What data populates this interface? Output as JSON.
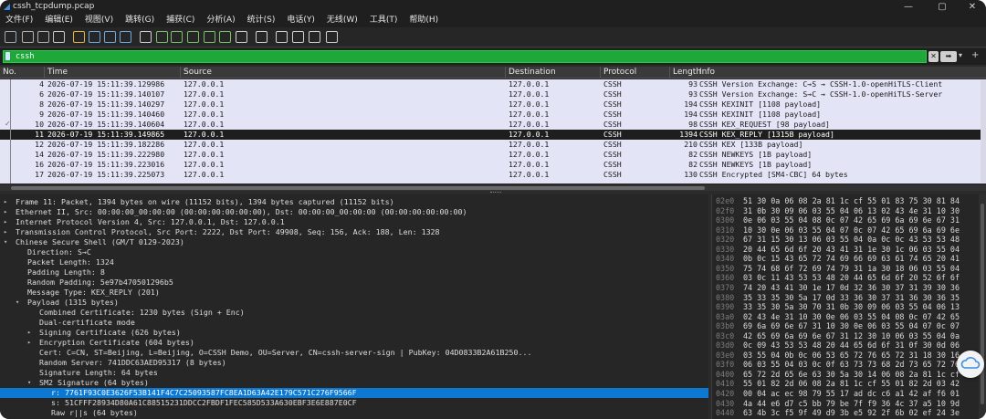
{
  "window": {
    "title": "cssh_tcpdump.pcap",
    "controls": [
      "—",
      "▢",
      "✕"
    ]
  },
  "menu": [
    "文件(F)",
    "编辑(E)",
    "视图(V)",
    "跳转(G)",
    "捕获(C)",
    "分析(A)",
    "统计(S)",
    "电话(Y)",
    "无线(W)",
    "工具(T)",
    "帮助(H)"
  ],
  "toolbar_icons": [
    "shark-fin-start-icon",
    "stop-icon",
    "restart-icon",
    "options-gear-icon",
    "open-folder-icon",
    "save-icon",
    "close-file-icon",
    "reload-icon",
    "find-icon",
    "back-arrow-icon",
    "forward-arrow-icon",
    "go-to-packet-icon",
    "first-packet-icon",
    "last-packet-icon",
    "autoscroll-icon",
    "colorize-icon",
    "zoom-in-icon",
    "zoom-out-icon",
    "normal-size-icon",
    "resize-columns-icon"
  ],
  "filter": {
    "value": "cssh"
  },
  "packet_list": {
    "columns": [
      "No.",
      "Time",
      "Source",
      "Destination",
      "Protocol",
      "Length",
      "Info"
    ],
    "rows": [
      {
        "no": "4",
        "time": "2026-07-19 15:11:39.129986",
        "src": "127.0.0.1",
        "dst": "127.0.0.1",
        "proto": "CSSH",
        "len": "93",
        "info": "CSSH Version Exchange: C→S → CSSH-1.0-openHiTLS-Client",
        "selected": false
      },
      {
        "no": "6",
        "time": "2026-07-19 15:11:39.140107",
        "src": "127.0.0.1",
        "dst": "127.0.0.1",
        "proto": "CSSH",
        "len": "93",
        "info": "CSSH Version Exchange: S→C → CSSH-1.0-openHiTLS-Server",
        "selected": false
      },
      {
        "no": "8",
        "time": "2026-07-19 15:11:39.140297",
        "src": "127.0.0.1",
        "dst": "127.0.0.1",
        "proto": "CSSH",
        "len": "194",
        "info": "CSSH KEXINIT  [1108 payload]",
        "selected": false
      },
      {
        "no": "9",
        "time": "2026-07-19 15:11:39.140460",
        "src": "127.0.0.1",
        "dst": "127.0.0.1",
        "proto": "CSSH",
        "len": "194",
        "info": "CSSH KEXINIT  [1108 payload]",
        "selected": false
      },
      {
        "no": "10",
        "time": "2026-07-19 15:11:39.140604",
        "src": "127.0.0.1",
        "dst": "127.0.0.1",
        "proto": "CSSH",
        "len": "98",
        "info": "CSSH KEX_REQUEST  [98 payload]",
        "selected": false
      },
      {
        "no": "11",
        "time": "2026-07-19 15:11:39.149865",
        "src": "127.0.0.1",
        "dst": "127.0.0.1",
        "proto": "CSSH",
        "len": "1394",
        "info": "CSSH KEX_REPLY  [1315B payload]",
        "selected": true
      },
      {
        "no": "12",
        "time": "2026-07-19 15:11:39.182286",
        "src": "127.0.0.1",
        "dst": "127.0.0.1",
        "proto": "CSSH",
        "len": "210",
        "info": "CSSH KEX  [133B payload]",
        "selected": false
      },
      {
        "no": "14",
        "time": "2026-07-19 15:11:39.222980",
        "src": "127.0.0.1",
        "dst": "127.0.0.1",
        "proto": "CSSH",
        "len": "82",
        "info": "CSSH NEWKEYS  [1B payload]",
        "selected": false
      },
      {
        "no": "16",
        "time": "2026-07-19 15:11:39.223016",
        "src": "127.0.0.1",
        "dst": "127.0.0.1",
        "proto": "CSSH",
        "len": "82",
        "info": "CSSH NEWKEYS  [1B payload]",
        "selected": false
      },
      {
        "no": "17",
        "time": "2026-07-19 15:11:39.225073",
        "src": "127.0.0.1",
        "dst": "127.0.0.1",
        "proto": "CSSH",
        "len": "130",
        "info": "CSSH Encrypted [SM4-CBC]  64 bytes",
        "selected": false
      }
    ]
  },
  "detail_tree": [
    {
      "level": 0,
      "arrow": "▸",
      "text": "Frame 11: Packet, 1394 bytes on wire (11152 bits), 1394 bytes captured (11152 bits)",
      "selected": false
    },
    {
      "level": 0,
      "arrow": "▸",
      "text": "Ethernet II, Src: 00:00:00_00:00:00 (00:00:00:00:00:00), Dst: 00:00:00_00:00:00 (00:00:00:00:00:00)",
      "selected": false
    },
    {
      "level": 0,
      "arrow": "▸",
      "text": "Internet Protocol Version 4, Src: 127.0.0.1, Dst: 127.0.0.1",
      "selected": false
    },
    {
      "level": 0,
      "arrow": "▸",
      "text": "Transmission Control Protocol, Src Port: 2222, Dst Port: 49908, Seq: 156, Ack: 188, Len: 1328",
      "selected": false
    },
    {
      "level": 0,
      "arrow": "▾",
      "text": "Chinese Secure Shell (GM/T 0129-2023)",
      "selected": false
    },
    {
      "level": 1,
      "arrow": "",
      "text": "Direction: S→C",
      "selected": false
    },
    {
      "level": 1,
      "arrow": "",
      "text": "Packet Length: 1324",
      "selected": false
    },
    {
      "level": 1,
      "arrow": "",
      "text": "Padding Length: 8",
      "selected": false
    },
    {
      "level": 1,
      "arrow": "",
      "text": "Random Padding: 5e97b470501296b5",
      "selected": false
    },
    {
      "level": 1,
      "arrow": "",
      "text": "Message Type: KEX_REPLY (201)",
      "selected": false
    },
    {
      "level": 1,
      "arrow": "▾",
      "text": "Payload (1315 bytes)",
      "selected": false
    },
    {
      "level": 2,
      "arrow": "",
      "text": "Combined Certificate: 1230 bytes (Sign + Enc)",
      "selected": false
    },
    {
      "level": 2,
      "arrow": "",
      "text": "Dual-certificate mode",
      "selected": false
    },
    {
      "level": 2,
      "arrow": "▸",
      "text": "Signing Certificate (626 bytes)",
      "selected": false
    },
    {
      "level": 2,
      "arrow": "▸",
      "text": "Encryption Certificate (604 bytes)",
      "selected": false
    },
    {
      "level": 2,
      "arrow": "",
      "text": "Cert: C=CN, ST=Beijing, L=Beijing, O=CSSH Demo, OU=Server, CN=cssh-server-sign | PubKey: 04D0833B2A61B250...",
      "selected": false
    },
    {
      "level": 2,
      "arrow": "",
      "text": "Random Server: 741DDC63AED95317 (8 bytes)",
      "selected": false
    },
    {
      "level": 2,
      "arrow": "",
      "text": "Signature Length: 64 bytes",
      "selected": false
    },
    {
      "level": 2,
      "arrow": "▾",
      "text": "SM2 Signature (64 bytes)",
      "selected": false
    },
    {
      "level": 3,
      "arrow": "",
      "text": "r: 7761F93C0E3626F53B141F4C7C25093587FC8EA1D63A42E179C571C276F9566F",
      "selected": true
    },
    {
      "level": 3,
      "arrow": "",
      "text": "s: 51CFFF28934D80A61C88515231DDCC2FBDF1FEC585D533A630EBF3E6E887E0CF",
      "selected": false
    },
    {
      "level": 3,
      "arrow": "",
      "text": "Raw r||s (64 bytes)",
      "selected": false
    }
  ],
  "hex_dump": [
    {
      "off": "02e0",
      "hex": "51 30 0a 06 08 2a 81 1c  cf 55 01 83 75 30 81 84"
    },
    {
      "off": "02f0",
      "hex": "31 0b 30 09 06 03 55 04  06 13 02 43 4e 31 10 30"
    },
    {
      "off": "0300",
      "hex": "0e 06 03 55 04 08 0c 07  42 65 69 6a 69 6e 67 31"
    },
    {
      "off": "0310",
      "hex": "10 30 0e 06 03 55 04 07  0c 07 42 65 69 6a 69 6e"
    },
    {
      "off": "0320",
      "hex": "67 31 15 30 13 06 03 55  04 0a 0c 0c 43 53 53 48"
    },
    {
      "off": "0330",
      "hex": "20 44 65 6d 6f 20 43 41  31 1e 30 1c 06 03 55 04"
    },
    {
      "off": "0340",
      "hex": "0b 0c 15 43 65 72 74 69  66 69 63 61 74 65 20 41"
    },
    {
      "off": "0350",
      "hex": "75 74 68 6f 72 69 74 79  31 1a 30 18 06 03 55 04"
    },
    {
      "off": "0360",
      "hex": "03 0c 11 43 53 53 48 20  44 65 6d 6f 20 52 6f 6f"
    },
    {
      "off": "0370",
      "hex": "74 20 43 41 30 1e 17 0d  32 36 30 37 31 39 30 36"
    },
    {
      "off": "0380",
      "hex": "35 33 35 30 5a 17 0d 33  36 30 37 31 36 30 36 35"
    },
    {
      "off": "0390",
      "hex": "33 35 30 5a 30 70 31 0b  30 09 06 03 55 04 06 13"
    },
    {
      "off": "03a0",
      "hex": "02 43 4e 31 10 30 0e 06  03 55 04 08 0c 07 42 65"
    },
    {
      "off": "03b0",
      "hex": "69 6a 69 6e 67 31 10 30  0e 06 03 55 04 07 0c 07"
    },
    {
      "off": "03c0",
      "hex": "42 65 69 6a 69 6e 67 31  12 30 10 06 03 55 04 0a"
    },
    {
      "off": "03d0",
      "hex": "0c 09 43 53 53 48 20 44  65 6d 6f 31 0f 30 0d 06"
    },
    {
      "off": "03e0",
      "hex": "03 55 04 0b 0c 06 53 65  72 76 65 72 31 18 30 16"
    },
    {
      "off": "03f0",
      "hex": "06 03 55 04 03 0c 0f 63  73 73 68 2d 73 65 72 76"
    },
    {
      "off": "0400",
      "hex": "65 72 2d 65 6e 63 30 5a  30 14 06 08 2a 81 1c cf"
    },
    {
      "off": "0410",
      "hex": "55 01 82 2d 06 08 2a 81  1c cf 55 01 82 2d 03 42"
    },
    {
      "off": "0420",
      "hex": "00 04 ac ec 98 79 55 17  ad dc c6 a1 42 af f6 01"
    },
    {
      "off": "0430",
      "hex": "4a 44 e6 d7 c5 bb 79 be  7f f9 36 4c 37 a5 10 9d"
    },
    {
      "off": "0440",
      "hex": "63 4b 3c f5 9f 49 d9 3b  e5 92 2f 6b 02 ef 24 3e"
    }
  ],
  "colors": {
    "filter_green": "#1ea83a",
    "row_bg": "#e4e4f7",
    "selected_row": "#1e1e1e",
    "tree_selected": "#0c78d2"
  }
}
